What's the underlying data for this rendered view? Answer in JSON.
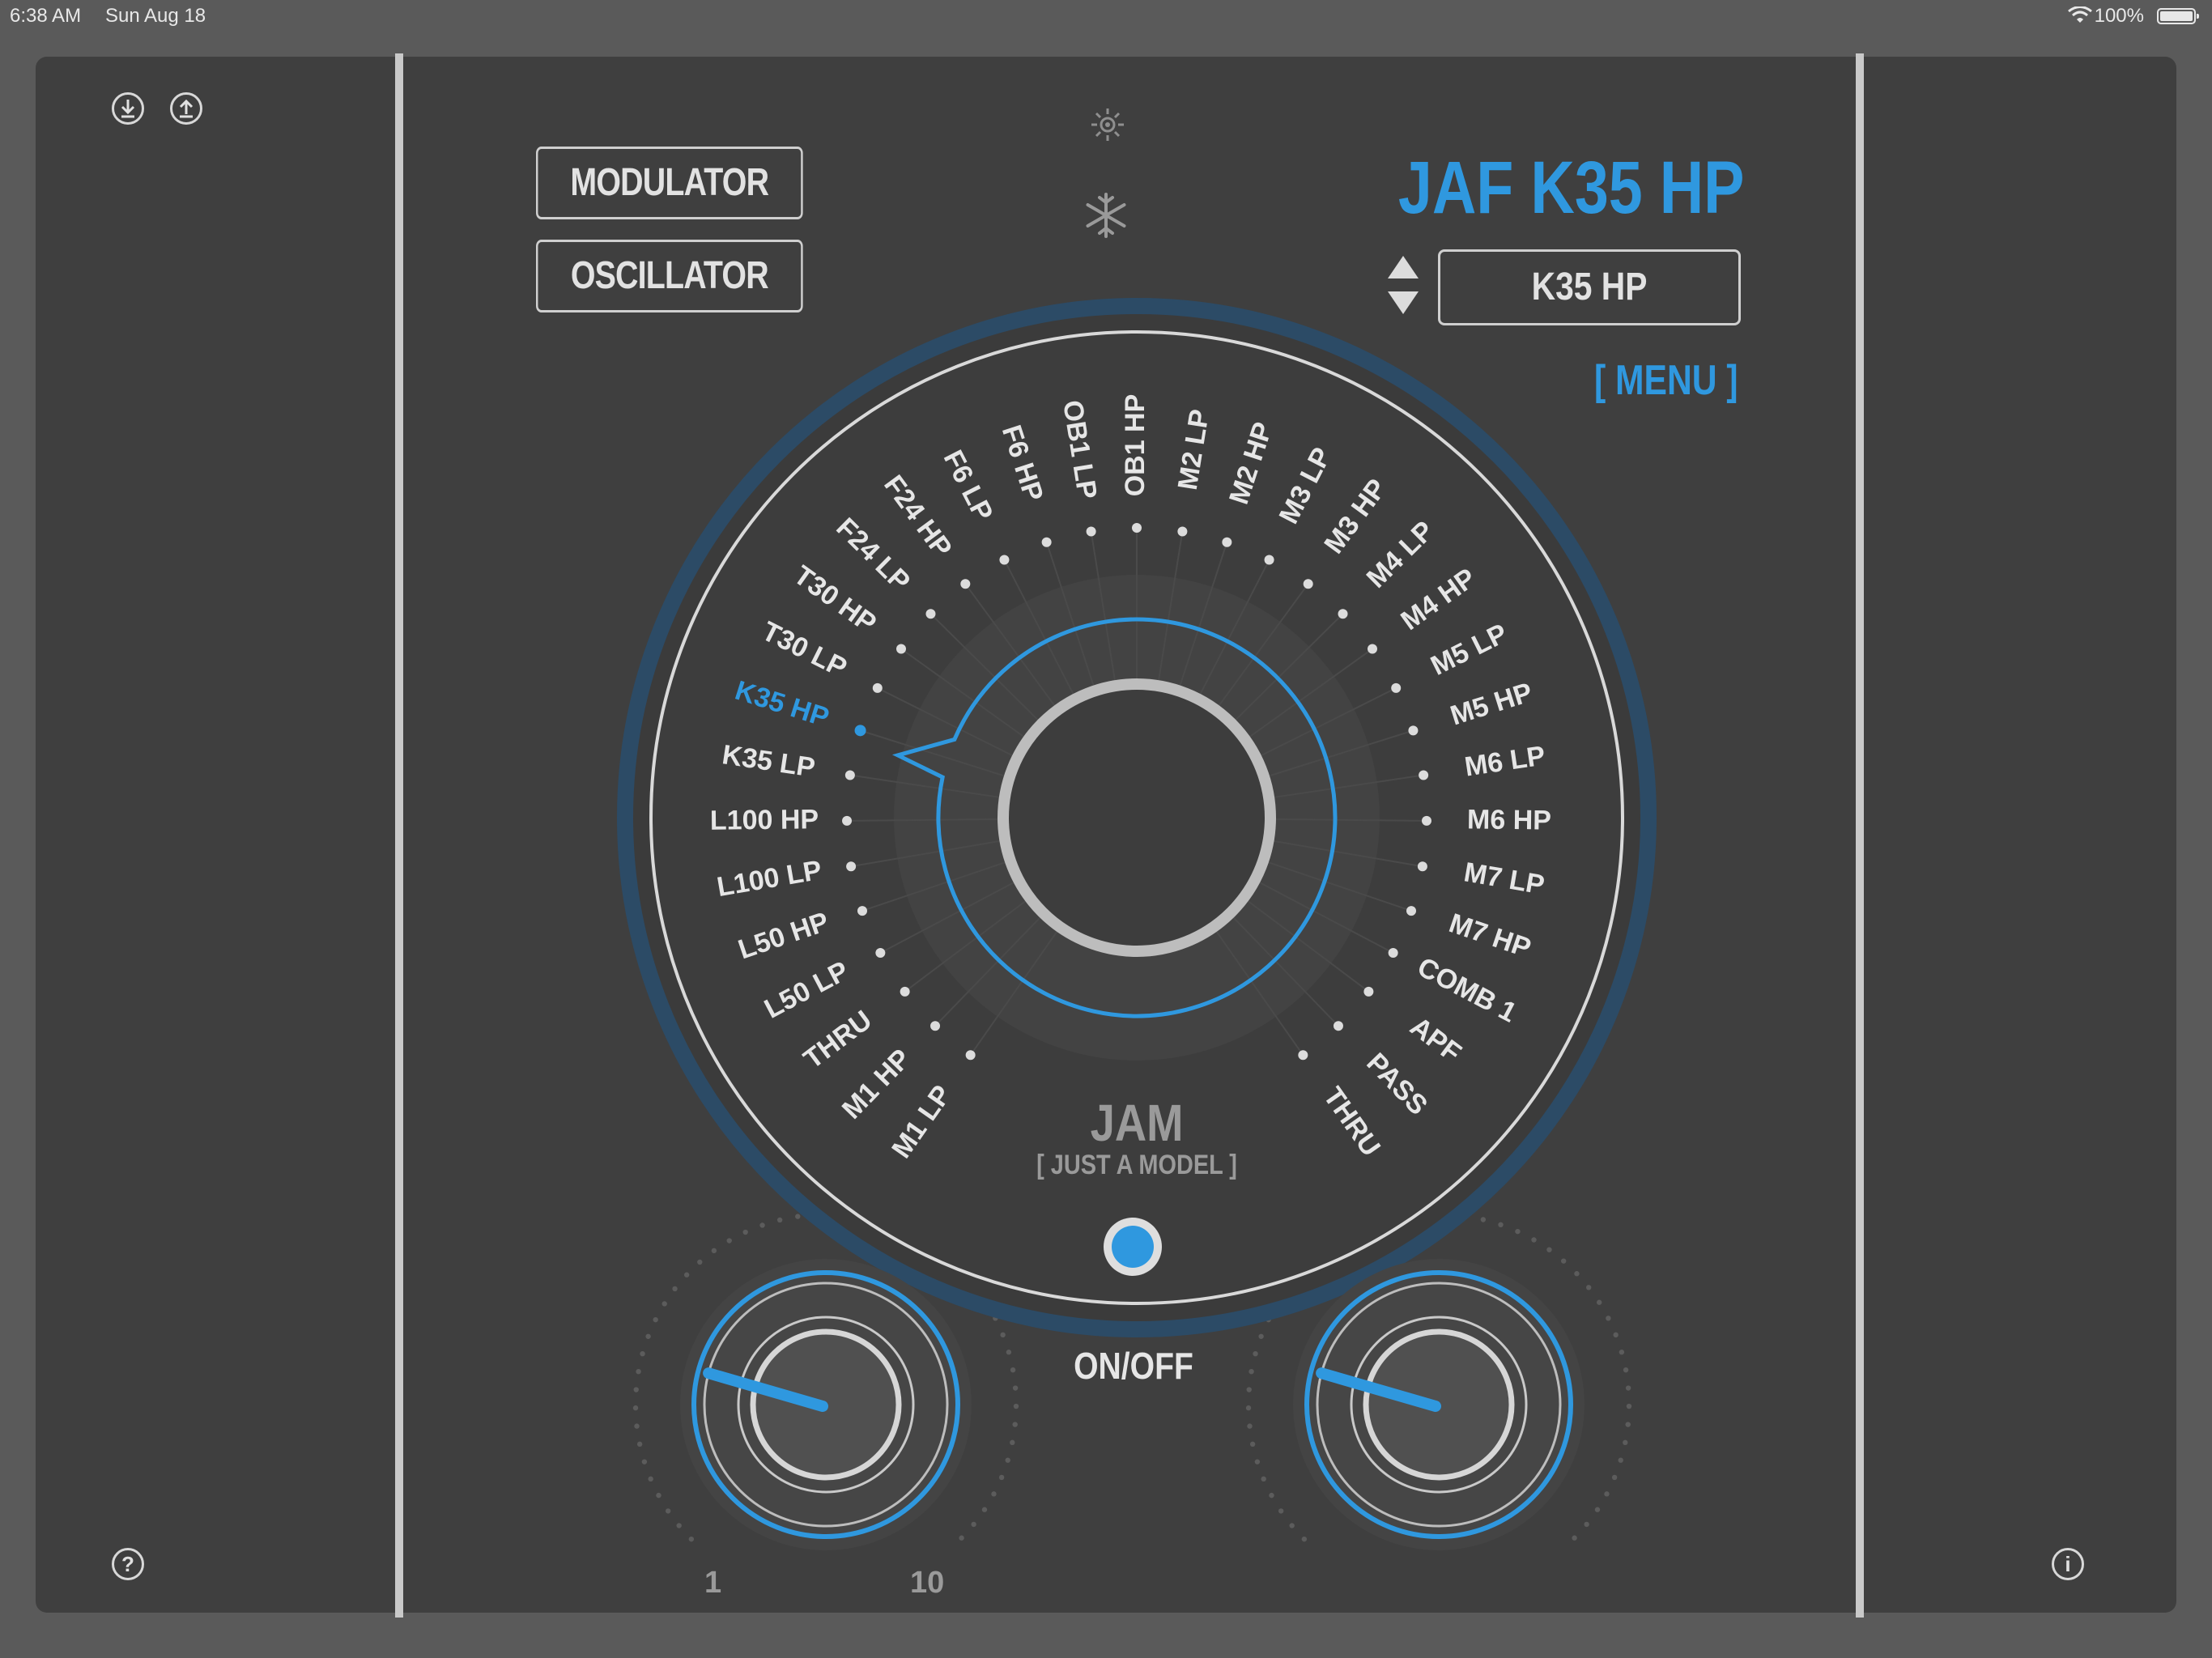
{
  "status_bar": {
    "time": "6:38 AM",
    "date": "Sun Aug 18",
    "battery": "100%"
  },
  "toolbar": {
    "import_icon": "download-circle-icon",
    "export_icon": "upload-circle-icon"
  },
  "buttons": {
    "modulator": "MODULATOR",
    "oscillator": "OSCILLATOR"
  },
  "indicators": {
    "brightness_icon": "sun-icon",
    "freeze_icon": "snowflake-icon"
  },
  "header": {
    "title": "JAF K35 HP",
    "model_value": "K35 HP",
    "menu": "[ MENU ]"
  },
  "filter_selector": {
    "selected": "K35 HP",
    "left_labels": [
      "M1 LP",
      "M1 HP",
      "THRU",
      "L50 LP",
      "L50 HP",
      "L100 LP",
      "L100 HP",
      "K35 LP",
      "K35 HP",
      "T30 LP",
      "T30 HP",
      "F24 LP",
      "F24 HP",
      "F6 LP",
      "F6 HP",
      "OB1 LP"
    ],
    "right_labels": [
      "OB1 HP",
      "M2 LP",
      "M2 HP",
      "M3 LP",
      "M3 HP",
      "M4 LP",
      "M4 HP",
      "M5 LP",
      "M5 HP",
      "M6 LP",
      "M6 HP",
      "M7 LP",
      "M7 HP",
      "COMB 1",
      "APF",
      "PASS",
      "THRU"
    ]
  },
  "brand": {
    "name": "JAM",
    "subtitle": "[ JUST A MODEL ]"
  },
  "power": {
    "label": "ON/OFF"
  },
  "knob_scale": {
    "min": "1",
    "max": "10"
  },
  "footer": {
    "help_icon": "question-circle-icon",
    "info_icon": "info-circle-icon"
  },
  "colors": {
    "accent": "#2f98df",
    "panel": "#3f3f3f",
    "background": "#5a5a5a"
  }
}
